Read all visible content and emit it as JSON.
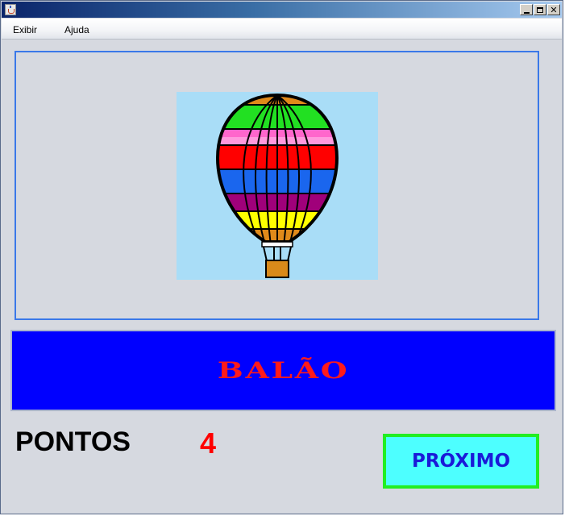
{
  "window": {
    "title": "",
    "controls": {
      "minimize_icon": "minimize-icon",
      "maximize_icon": "maximize-icon",
      "close_glyph": "✕"
    }
  },
  "menu": {
    "items": [
      {
        "label": "Exibir"
      },
      {
        "label": "Ajuda"
      }
    ]
  },
  "image": {
    "subject": "hot-air-balloon",
    "background": "#a9ddf7"
  },
  "word": {
    "text": "BALÃO",
    "text_color": "#ff1a1a",
    "panel_color": "#0000ff"
  },
  "score": {
    "label": "PONTOS",
    "value": "4"
  },
  "next_button": {
    "label": "PRÓXIMO",
    "background": "#4dffff",
    "border": "#22ee22"
  }
}
